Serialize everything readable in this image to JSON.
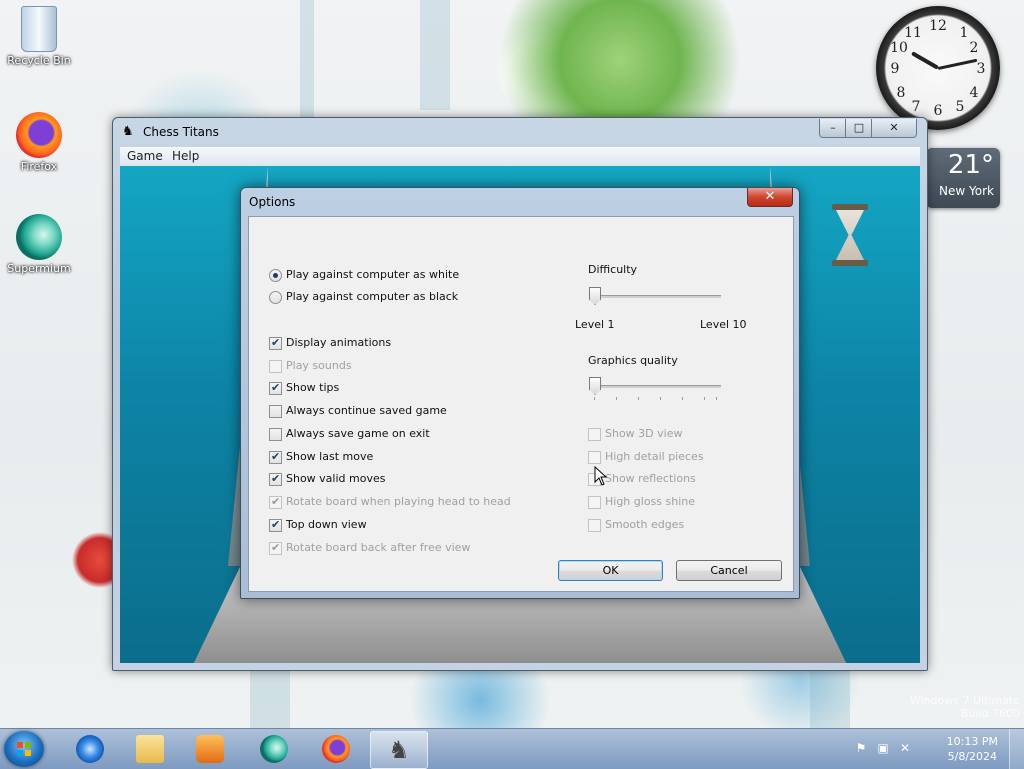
{
  "desktop": {
    "icons": [
      {
        "label": "Recycle Bin",
        "icon": "recycle-bin-icon"
      },
      {
        "label": "Firefox",
        "icon": "firefox-icon"
      },
      {
        "label": "Supermium",
        "icon": "supermium-icon"
      }
    ],
    "watermark": {
      "line1": "Windows 7 Ultimate",
      "line2": "Build 7600"
    }
  },
  "gadgets": {
    "clock": {
      "numbers": [
        "12",
        "1",
        "2",
        "3",
        "4",
        "5",
        "6",
        "7",
        "8",
        "9",
        "10",
        "11"
      ]
    },
    "weather": {
      "temp": "21°",
      "city": "New York"
    }
  },
  "chess_window": {
    "title": "Chess Titans",
    "menu": [
      "Game",
      "Help"
    ],
    "controls": {
      "minimize": "–",
      "maximize": "□",
      "close": "✕"
    }
  },
  "options_dialog": {
    "title": "Options",
    "close": "✕",
    "play_mode": [
      {
        "label": "Play against computer as white",
        "selected": true
      },
      {
        "label": "Play against computer as black",
        "selected": false
      }
    ],
    "left_checks": [
      {
        "label": "Display animations",
        "checked": true,
        "enabled": true
      },
      {
        "label": "Play sounds",
        "checked": false,
        "enabled": false
      },
      {
        "label": "Show tips",
        "checked": true,
        "enabled": true
      },
      {
        "label": "Always continue saved game",
        "checked": false,
        "enabled": true
      },
      {
        "label": "Always save game on exit",
        "checked": false,
        "enabled": true
      },
      {
        "label": "Show last move",
        "checked": true,
        "enabled": true
      },
      {
        "label": "Show valid moves",
        "checked": true,
        "enabled": true
      },
      {
        "label": "Rotate board when playing head to head",
        "checked": true,
        "enabled": false
      },
      {
        "label": "Top down view",
        "checked": true,
        "enabled": true
      },
      {
        "label": "Rotate board back after free view",
        "checked": true,
        "enabled": false
      }
    ],
    "difficulty": {
      "label": "Difficulty",
      "min_label": "Level 1",
      "max_label": "Level 10",
      "value": 1,
      "min": 1,
      "max": 10
    },
    "graphics": {
      "label": "Graphics quality",
      "value": 0,
      "min": 0,
      "max": 6
    },
    "right_checks": [
      {
        "label": "Show 3D view",
        "checked": false,
        "enabled": false
      },
      {
        "label": "High detail pieces",
        "checked": false,
        "enabled": false
      },
      {
        "label": "Show reflections",
        "checked": false,
        "enabled": false
      },
      {
        "label": "High gloss shine",
        "checked": false,
        "enabled": false
      },
      {
        "label": "Smooth edges",
        "checked": false,
        "enabled": false
      }
    ],
    "ok_label": "OK",
    "cancel_label": "Cancel"
  },
  "taskbar": {
    "items": [
      {
        "name": "internet-explorer",
        "icon": "ie-icon",
        "active": false
      },
      {
        "name": "windows-explorer",
        "icon": "folder-icon",
        "active": false
      },
      {
        "name": "media-player",
        "icon": "media-player-icon",
        "active": false
      },
      {
        "name": "supermium",
        "icon": "supermium-icon",
        "active": false
      },
      {
        "name": "firefox",
        "icon": "firefox-icon",
        "active": false
      },
      {
        "name": "chess-titans",
        "icon": "chess-knight-icon",
        "active": true
      }
    ],
    "time": "10:13 PM",
    "date": "5/8/2024"
  }
}
